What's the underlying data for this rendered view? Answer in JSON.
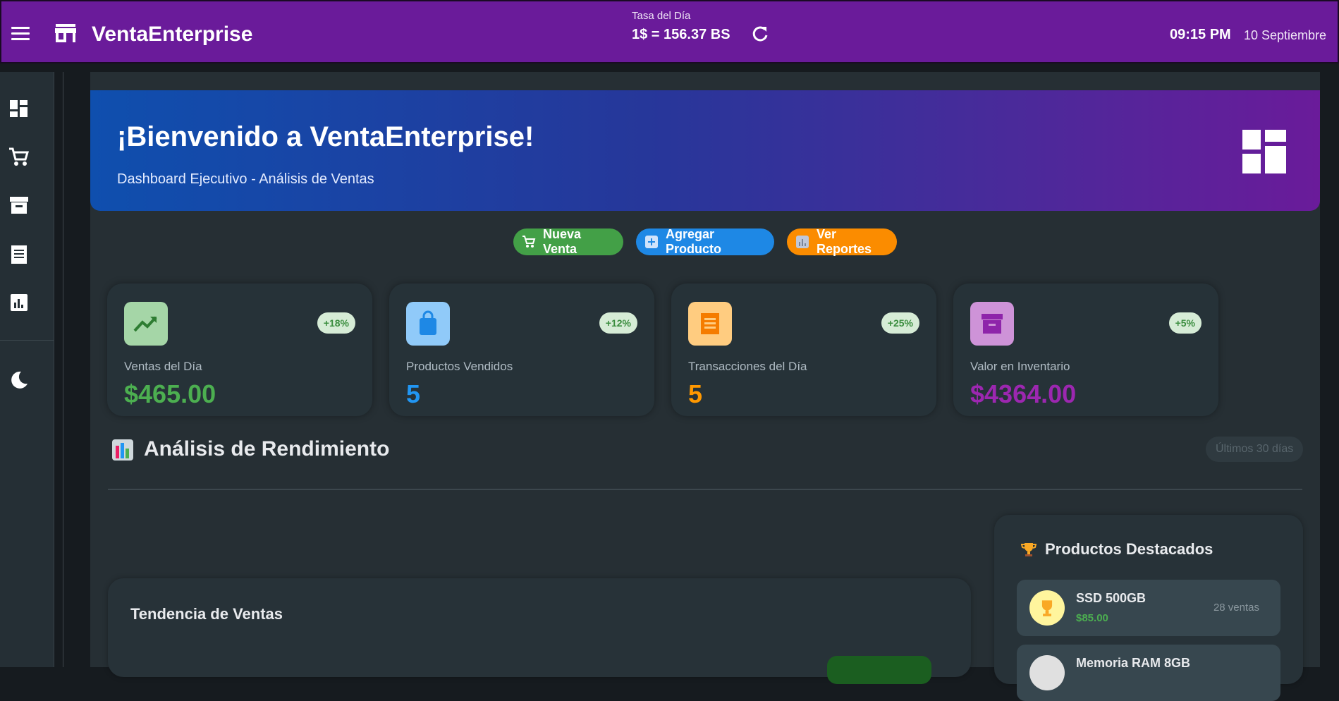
{
  "header": {
    "app_title": "VentaEnterprise",
    "rate_label": "Tasa del Día",
    "rate_value": "1$ = 156.37 BS",
    "time": "09:15 PM",
    "date": "10 Septiembre",
    "color": "#6a1b9a"
  },
  "sidebar": {
    "items": [
      {
        "icon": "dashboard-icon"
      },
      {
        "icon": "cart-icon"
      },
      {
        "icon": "archive-icon"
      },
      {
        "icon": "receipt-icon"
      },
      {
        "icon": "bar-chart-icon"
      },
      {
        "icon": "moon-icon"
      }
    ]
  },
  "banner": {
    "title": "¡Bienvenido a VentaEnterprise!",
    "subtitle": "Dashboard Ejecutivo - Análisis de Ventas",
    "icon": "dashboard-icon"
  },
  "actions": [
    {
      "label": "Nueva Venta",
      "icon": "cart-plus-icon",
      "color": "#43a047"
    },
    {
      "label": "Agregar Producto",
      "icon": "plus-box-icon",
      "color": "#1e88e5"
    },
    {
      "label": "Ver Reportes",
      "icon": "chart-box-icon",
      "color": "#fb8c00"
    }
  ],
  "stats": [
    {
      "label": "Ventas del Día",
      "value": "$465.00",
      "badge": "+18%",
      "icon": "trending-up-icon",
      "color": "#4caf50"
    },
    {
      "label": "Productos Vendidos",
      "value": "5",
      "badge": "+12%",
      "icon": "shopping-bag-icon",
      "color": "#2196f3"
    },
    {
      "label": "Transacciones del Día",
      "value": "5",
      "badge": "+25%",
      "icon": "receipt-icon",
      "color": "#ff9800"
    },
    {
      "label": "Valor en Inventario",
      "value": "$4364.00",
      "badge": "+5%",
      "icon": "archive-icon",
      "color": "#9c27b0"
    }
  ],
  "analysis": {
    "title": "Análisis de Rendimiento",
    "period": "Últimos 30 días",
    "trend_title": "Tendencia de Ventas"
  },
  "top_products": {
    "title": "Productos Destacados",
    "items": [
      {
        "name": "SSD 500GB",
        "price": "$85.00",
        "sales": "28 ventas"
      },
      {
        "name": "Memoria RAM 8GB",
        "price": "",
        "sales": ""
      }
    ]
  }
}
